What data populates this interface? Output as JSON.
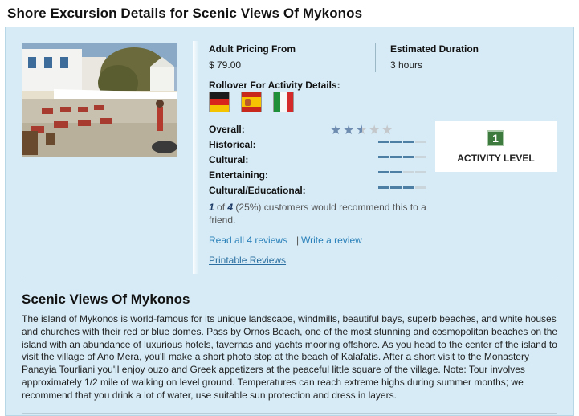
{
  "header": {
    "title": "Shore Excursion Details for Scenic Views Of Mykonos"
  },
  "pricing": {
    "label": "Adult Pricing From",
    "value": "$ 79.00"
  },
  "duration": {
    "label": "Estimated Duration",
    "value": "3 hours"
  },
  "rollover": {
    "label": "Rollover For Activity Details:",
    "flags": [
      "german-flag",
      "spanish-flag",
      "italian-flag"
    ]
  },
  "ratings": {
    "overall_label": "Overall:",
    "overall_stars": 2.5,
    "categories": [
      {
        "label": "Historical:",
        "level": 3
      },
      {
        "label": "Cultural:",
        "level": 3
      },
      {
        "label": "Entertaining:",
        "level": 2
      },
      {
        "label": "Cultural/Educational:",
        "level": 3
      }
    ]
  },
  "activity_level": {
    "number": "1",
    "label": "ACTIVITY LEVEL",
    "color": "#3d7a3d"
  },
  "recommend": {
    "count": "1",
    "of_text": "of",
    "total": "4",
    "rest": "(25%) customers would recommend this to a friend."
  },
  "links": {
    "read_reviews": "Read all 4 reviews",
    "separator": "|",
    "write_review": "Write a review",
    "printable": "Printable Reviews"
  },
  "description": {
    "title": "Scenic Views Of Mykonos",
    "body": "The island of Mykonos is world-famous for its unique landscape, windmills, beautiful bays, superb beaches, and white houses and churches with their red or blue domes. Pass by Ornos Beach, one of the most stunning and cosmopolitan beaches on the island with an abundance of luxurious hotels, tavernas and yachts mooring offshore. As you head to the center of the island to visit the village of Ano Mera, you'll make a short photo stop at the beach of Kalafatis. After a short visit to the Monastery Panayia Tourliani you'll enjoy ouzo and Greek appetizers at the peaceful little square of the village. Note: Tour involves approximately 1/2 mile of walking on level ground. Temperatures can reach extreme highs during summer months; we recommend that you drink a lot of water, use suitable sun protection and dress in layers."
  },
  "colors": {
    "panel": "#d6ebf6",
    "link": "#2a80b9",
    "bar_on": "#4c7fa3",
    "bar_off": "#c9d4db"
  }
}
